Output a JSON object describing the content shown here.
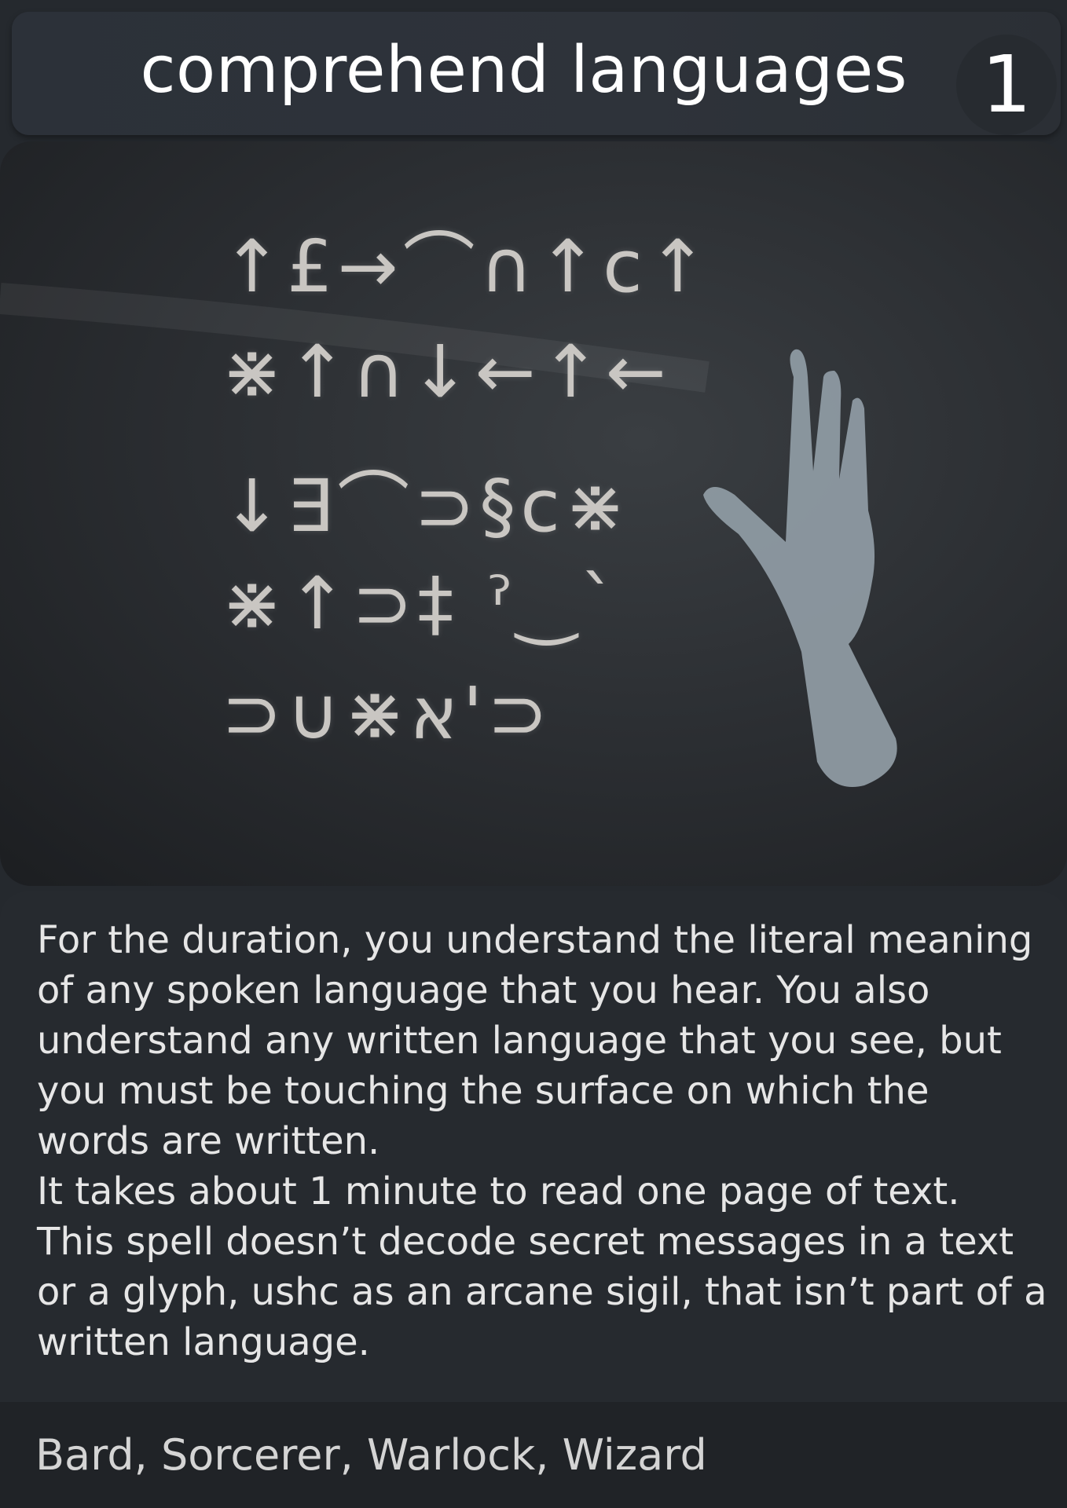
{
  "header": {
    "title": "comprehend languages",
    "level": "1"
  },
  "image": {
    "glyph_rows": [
      "↑£→⌒∩↑c↑",
      "⋇↑∩↓←↑←",
      "↓∃⌒⊃§c⋇",
      "⋇↑⊃‡ ˀ‿ˋ",
      "⊃∪⋇א'⊃"
    ]
  },
  "description": {
    "paragraphs": [
      "For the duration, you understand the literal meaning of any spoken language that you hear. You also understand any written language that you see, but you must be touching the surface on which the words are written.",
      "It takes about 1 minute to read one page of text.",
      "This spell doesn’t decode secret messages in a text or a glyph, ushc as an arcane sigil, that isn’t part of a written language."
    ]
  },
  "footer": {
    "classes": "Bard, Sorcerer, Warlock, Wizard"
  }
}
